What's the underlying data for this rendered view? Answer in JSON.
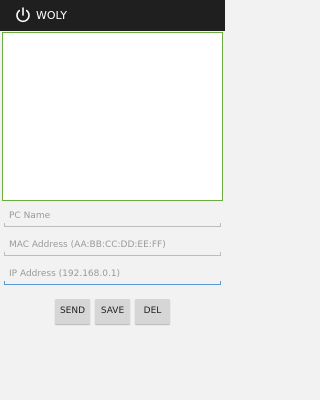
{
  "app": {
    "title": "WOLY",
    "icon": "power-icon"
  },
  "form": {
    "pc_name": {
      "placeholder": "PC Name",
      "value": ""
    },
    "mac": {
      "placeholder": "MAC Address (AA:BB:CC:DD:EE:FF)",
      "value": ""
    },
    "ip": {
      "placeholder": "IP Address (192.168.0.1)",
      "value": ""
    }
  },
  "buttons": {
    "send": "SEND",
    "save": "SAVE",
    "del": "DEL"
  },
  "colors": {
    "action_bar": "#1f1f1f",
    "list_border": "#6bad3f",
    "focus_underline": "#5b9bd5"
  }
}
